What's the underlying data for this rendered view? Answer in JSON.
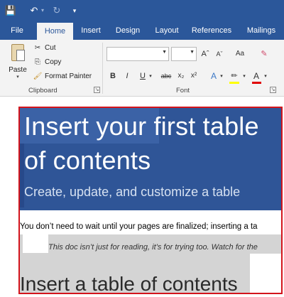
{
  "quick_access": {
    "save_icon": "floppy-disk-icon",
    "undo_icon": "undo-icon",
    "redo_icon": "redo-icon",
    "customize_icon": "customize-qat-icon"
  },
  "tabs": [
    {
      "label": "File"
    },
    {
      "label": "Home",
      "active": true
    },
    {
      "label": "Insert"
    },
    {
      "label": "Design"
    },
    {
      "label": "Layout"
    },
    {
      "label": "References"
    },
    {
      "label": "Mailings"
    }
  ],
  "ribbon": {
    "clipboard": {
      "group_label": "Clipboard",
      "paste_label": "Paste",
      "cut_label": "Cut",
      "copy_label": "Copy",
      "format_painter_label": "Format Painter"
    },
    "font": {
      "group_label": "Font",
      "font_name_value": "",
      "font_size_value": "",
      "grow_label": "Aˆ",
      "shrink_label": "Aˇ",
      "change_case_label": "Aa",
      "bold_label": "B",
      "italic_label": "I",
      "underline_label": "U",
      "strikethrough_label": "abc",
      "subscript_label": "x₂",
      "superscript_label": "x²",
      "text_effects_label": "A",
      "font_color_label": "A",
      "highlight_color": "#ffff00",
      "font_color": "#e00000"
    }
  },
  "document": {
    "hero_title": "Insert your first table of contents",
    "hero_subtitle": "Create, update, and customize a table",
    "paragraph_1": "You don’t need to wait until your pages are finalized; inserting a ta",
    "paragraph_2": "This doc isn’t just for reading, it’s for trying too. Watch for the",
    "heading_2": "Insert a table of contents"
  },
  "colors": {
    "ribbon_blue": "#2b579a",
    "hero_blue": "#2f5597",
    "selection_red": "#d3141c"
  }
}
